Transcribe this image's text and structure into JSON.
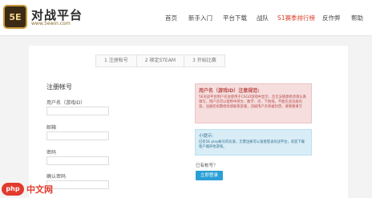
{
  "header": {
    "logo_badge": "5E",
    "logo_title": "对战平台",
    "logo_url": "www.5ewin.com",
    "nav": [
      "首页",
      "新手入门",
      "平台下载",
      "战队",
      "S1赛季排行榜",
      "反作弊",
      "帮助"
    ],
    "accent": "#d9412b"
  },
  "steps": [
    "1  注册帐号",
    "2  绑定STEAM",
    "3  开始比赛"
  ],
  "form": {
    "title": "注册帐号",
    "fields": [
      "用户名（游戏ID）",
      "邮箱",
      "密码",
      "确认密码"
    ]
  },
  "warning": {
    "title": "用户名（游戏ID）注意规范:",
    "text": "5E对战平台用户名会使用于CSGO游戏中显示，且无法随意修改请认真填写，用户名可以使用中英文、数字、点、下划线，不能包含违规内容，注册后如需修改请联系客服，违规用户名将被封禁，请慎重填写"
  },
  "info": {
    "title": "小提示:",
    "text": "已有5E play帐号的玩家，无需注册可以直接登录对战平台，欢迎下载客户端开始游戏。"
  },
  "has_account": "已有帐号？",
  "login_button": "立即登录",
  "watermark": {
    "icon": "php",
    "text": "中文网"
  }
}
